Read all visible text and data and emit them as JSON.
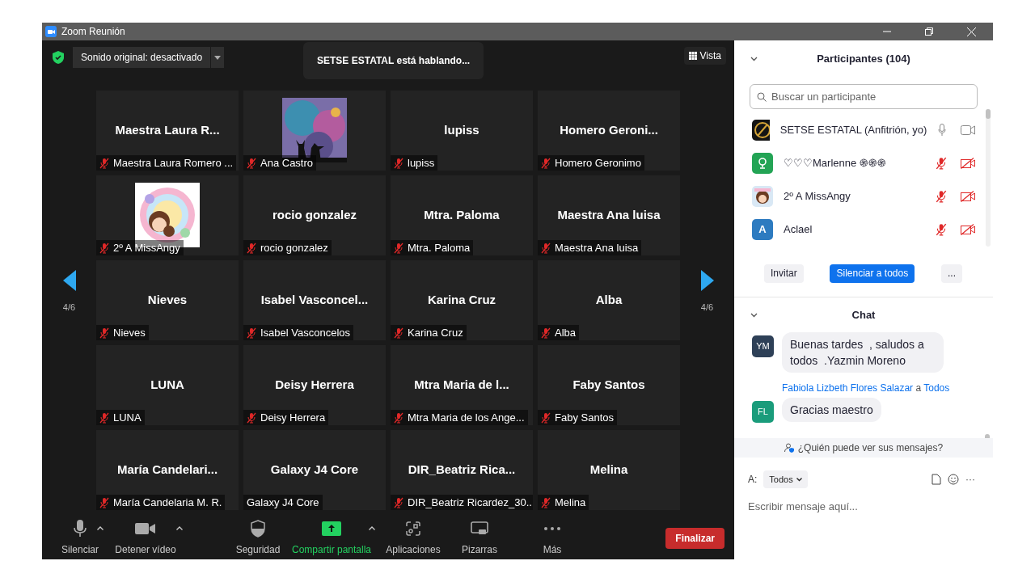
{
  "window": {
    "title": "Zoom Reunión"
  },
  "top_bar": {
    "audio_menu": "Sonido original: desactivado",
    "speaking": "SETSE ESTATAL está hablando...",
    "view_button": "Vista"
  },
  "pager": {
    "left": "4/6",
    "right": "4/6"
  },
  "tiles": [
    {
      "name": "Maestra  Laura R...",
      "label": "Maestra Laura Romero ...",
      "muted": true
    },
    {
      "kind": "picture",
      "label": "Ana Castro",
      "muted": true
    },
    {
      "name": "lupiss",
      "label": "lupiss",
      "muted": true
    },
    {
      "name": "Homero  Geroni...",
      "label": "Homero Geronimo",
      "muted": true
    },
    {
      "kind": "picture",
      "label": "2º A  MissAngy",
      "muted": true
    },
    {
      "name": "rocio gonzalez",
      "label": "rocio gonzalez",
      "muted": true
    },
    {
      "name": "Mtra. Paloma",
      "label": "Mtra. Paloma",
      "muted": true
    },
    {
      "name": "Maestra Ana luisa",
      "label": "Maestra Ana luisa",
      "muted": true
    },
    {
      "name": "Nieves",
      "label": "Nieves",
      "muted": true
    },
    {
      "name": "Isabel  Vasconcel...",
      "label": "Isabel Vasconcelos",
      "muted": true
    },
    {
      "name": "Karina Cruz",
      "label": "Karina Cruz",
      "muted": true
    },
    {
      "name": "Alba",
      "label": "Alba",
      "muted": true
    },
    {
      "name": "LUNA",
      "label": "LUNA",
      "muted": true
    },
    {
      "name": "Deisy Herrera",
      "label": "Deisy Herrera",
      "muted": true
    },
    {
      "name": "Mtra Maria de l...",
      "label": "Mtra Maria de los Ange...",
      "muted": true
    },
    {
      "name": "Faby Santos",
      "label": "Faby Santos",
      "muted": true
    },
    {
      "name": "María  Candelari...",
      "label": "María Candelaria M. R.",
      "muted": true
    },
    {
      "name": "Galaxy J4 Core",
      "label": "Galaxy J4 Core",
      "muted": false
    },
    {
      "name": "DIR_Beatriz  Rica...",
      "label": "DIR_Beatriz Ricardez_30...",
      "muted": true
    },
    {
      "name": "Melina",
      "label": "Melina",
      "muted": true
    }
  ],
  "toolbar": [
    {
      "kind": "mic",
      "label": "Silenciar",
      "caret": true
    },
    {
      "kind": "camera",
      "label": "Detener vídeo",
      "caret": true
    },
    {
      "kind": "shield",
      "label": "Seguridad",
      "caret": false
    },
    {
      "kind": "share",
      "label": "Compartir pantalla",
      "caret": true
    },
    {
      "kind": "apps",
      "label": "Aplicaciones",
      "caret": false
    },
    {
      "kind": "whiteboard",
      "label": "Pizarras",
      "caret": false
    },
    {
      "kind": "more",
      "label": "Más",
      "caret": false
    }
  ],
  "end_button": "Finalizar",
  "participants": {
    "title": "Participantes (104)",
    "search_placeholder": "Buscar un participante",
    "items": [
      {
        "name": "SETSE ESTATAL (Anfitrión, yo)",
        "audio_muted": false,
        "video_off": false
      },
      {
        "kind": "icon",
        "color": "#23a455",
        "name": "♡♡♡Marlenne ֍֍֍",
        "audio_muted": true,
        "video_off": true
      },
      {
        "name": "2º A  MissAngy",
        "audio_muted": true,
        "video_off": true
      },
      {
        "kind": "letter",
        "color": "#2d7bc0",
        "initial": "A",
        "name": "Aclael",
        "audio_muted": true,
        "video_off": true
      }
    ],
    "buttons": [
      "Invitar",
      "Silenciar a todos",
      "..."
    ]
  },
  "chat": {
    "title": "Chat",
    "messages": [
      {
        "initials": "YM",
        "color": "#2e4057",
        "text": "Buenas tardes  , saludos a todos  .Yazmin Moreno"
      },
      {
        "initials": "FL",
        "color": "#1a9c7b",
        "sender": "Fabiola Lizbeth Flores Salazar",
        "to_word": "a",
        "recipient": "Todos",
        "text": "Gracias maestro"
      }
    ],
    "privacy": "¿Quién puede ver sus mensajes?",
    "to_label": "A:",
    "to_value": "Todos",
    "input_placeholder": "Escribir mensaje aquí...",
    "more": "···"
  }
}
